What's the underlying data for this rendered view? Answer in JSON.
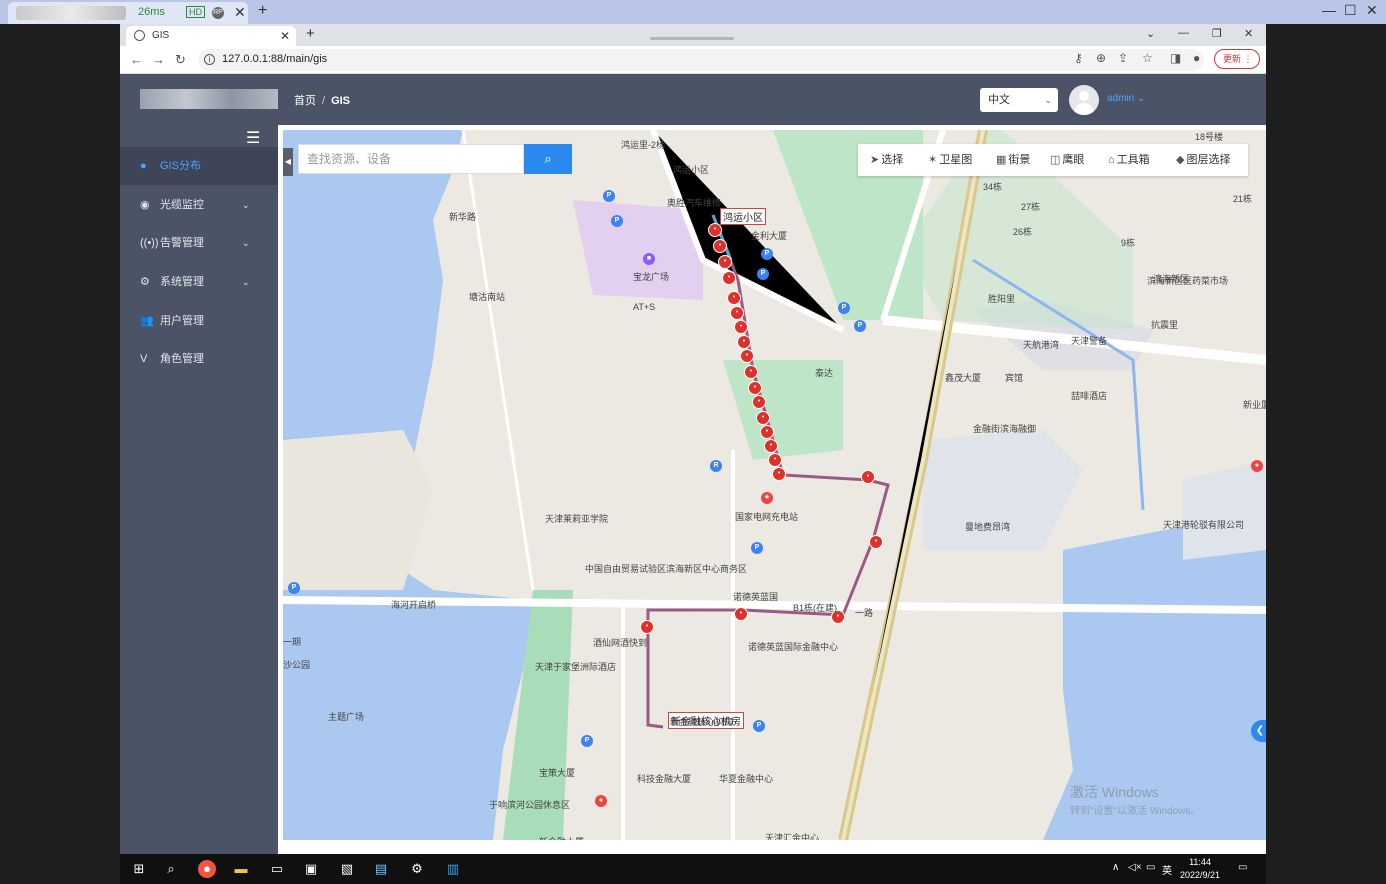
{
  "outer": {
    "perf_badge": "26ms",
    "hd_badge": "HD",
    "rp_badge": "RP"
  },
  "browser": {
    "tab_title": "GIS",
    "url": "127.0.0.1:88/main/gis",
    "update_label": "更新"
  },
  "header": {
    "breadcrumb_home": "首页",
    "breadcrumb_sep": "/",
    "breadcrumb_current": "GIS",
    "language": "中文",
    "user": "admin"
  },
  "sidebar": {
    "items": [
      {
        "label": "GIS分布",
        "icon": "dot-icon",
        "active": true
      },
      {
        "label": "光缆监控",
        "icon": "monitor-icon",
        "expandable": true
      },
      {
        "label": "告警管理",
        "icon": "alarm-icon",
        "expandable": true
      },
      {
        "label": "系统管理",
        "icon": "gear-icon",
        "expandable": true
      },
      {
        "label": "用户管理",
        "icon": "users-icon"
      },
      {
        "label": "角色管理",
        "icon": "role-icon"
      }
    ]
  },
  "map": {
    "search_placeholder": "查找资源、设备",
    "toolbar": [
      "选择",
      "卫星图",
      "街景",
      "鹰眼",
      "工具箱",
      "图层选择"
    ],
    "callouts": [
      "鸿运小区",
      "新金融核心机房"
    ],
    "labels": [
      "鸿运里-2杨",
      "鸿运小区",
      "奥胜汽车维修",
      "金利大厦",
      "宝龙广场",
      "AT+S",
      "塘沽南站",
      "新华路",
      "泰达",
      "滨海新区",
      "胜阳里",
      "滨海新区医药菜市场",
      "抗震里",
      "天航港湾",
      "天津警备",
      "鑫茂大厦",
      "宾馆",
      "喆啡酒店",
      "新业厦商务公",
      "金融街滨海融御",
      "天津港轮驳有限公司",
      "曼地费昂湾",
      "天津莱莉亚学院",
      "国家电网充电站",
      "中国自由贸易试验区滨海新区中心商务区",
      "诺德英蓝国",
      "海河开启桥",
      "一路",
      "酒仙网酒快到",
      "诺德英蓝国际金融中心",
      "天津于家堡洲际酒店",
      "主题广场",
      "新金融核心机房",
      "宝策大厦",
      "科技金融大厦",
      "华夏金融中心",
      "于响滨河公园休息区",
      "天津汇金中心",
      "新金融大厦",
      "18号楼",
      "21栋",
      "27栋",
      "26栋",
      "34栋",
      "9栋",
      "B1栋(在建)",
      "一期",
      "沙公园"
    ],
    "watermark": "激活 Windows",
    "watermark_sub": "转到\"设置\"以激活 Windows。"
  },
  "taskbar": {
    "time": "11:44",
    "date": "2022/9/21",
    "ime": "英"
  },
  "colors": {
    "header_bg": "#4b5467",
    "accent": "#2b8af0",
    "route": "#9b5a86",
    "node": "#e0302b"
  }
}
